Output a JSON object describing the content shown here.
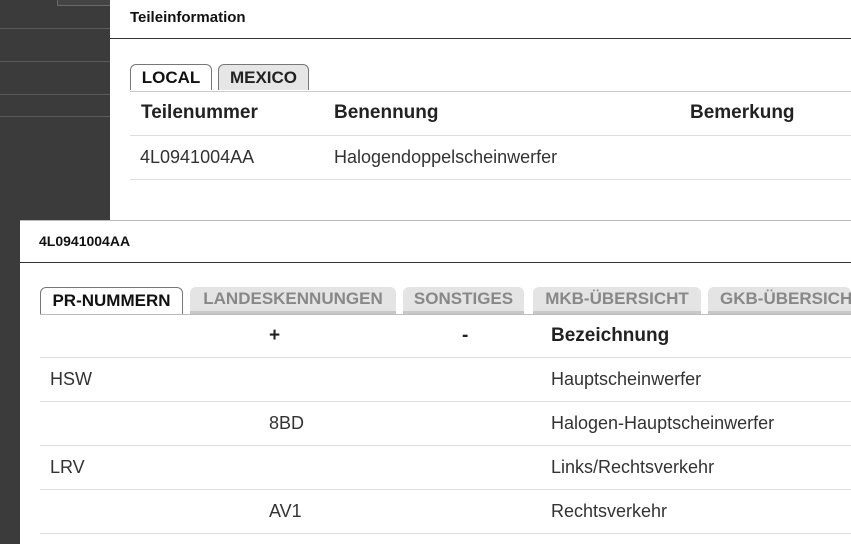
{
  "panel_top": {
    "title": "Teileinformation",
    "tabs": [
      {
        "label": "LOCAL",
        "active": true
      },
      {
        "label": "MEXICO",
        "active": false
      }
    ],
    "table": {
      "headers": [
        "Teilenummer",
        "Benennung",
        "Bemerkung"
      ],
      "rows": [
        [
          "4L0941004AA",
          "Halogendoppelscheinwerfer",
          ""
        ]
      ]
    }
  },
  "panel_detail": {
    "title": "4L0941004AA",
    "tabs": [
      {
        "label": "PR-NUMMERN",
        "active": true
      },
      {
        "label": "LANDESKENNUNGEN",
        "active": false
      },
      {
        "label": "SONSTIGES",
        "active": false
      },
      {
        "label": "MKB-ÜBERSICHT",
        "active": false
      },
      {
        "label": "GKB-ÜBERSICHT",
        "active": false
      }
    ],
    "table": {
      "headers": [
        "",
        "+",
        "-",
        "Bezeichnung"
      ],
      "rows": [
        [
          "HSW",
          "",
          "",
          "Hauptscheinwerfer"
        ],
        [
          "",
          "8BD",
          "",
          "Halogen-Hauptscheinwerfer"
        ],
        [
          "LRV",
          "",
          "",
          "Links/Rechtsverkehr"
        ],
        [
          "",
          "AV1",
          "",
          "Rechtsverkehr"
        ]
      ]
    }
  }
}
